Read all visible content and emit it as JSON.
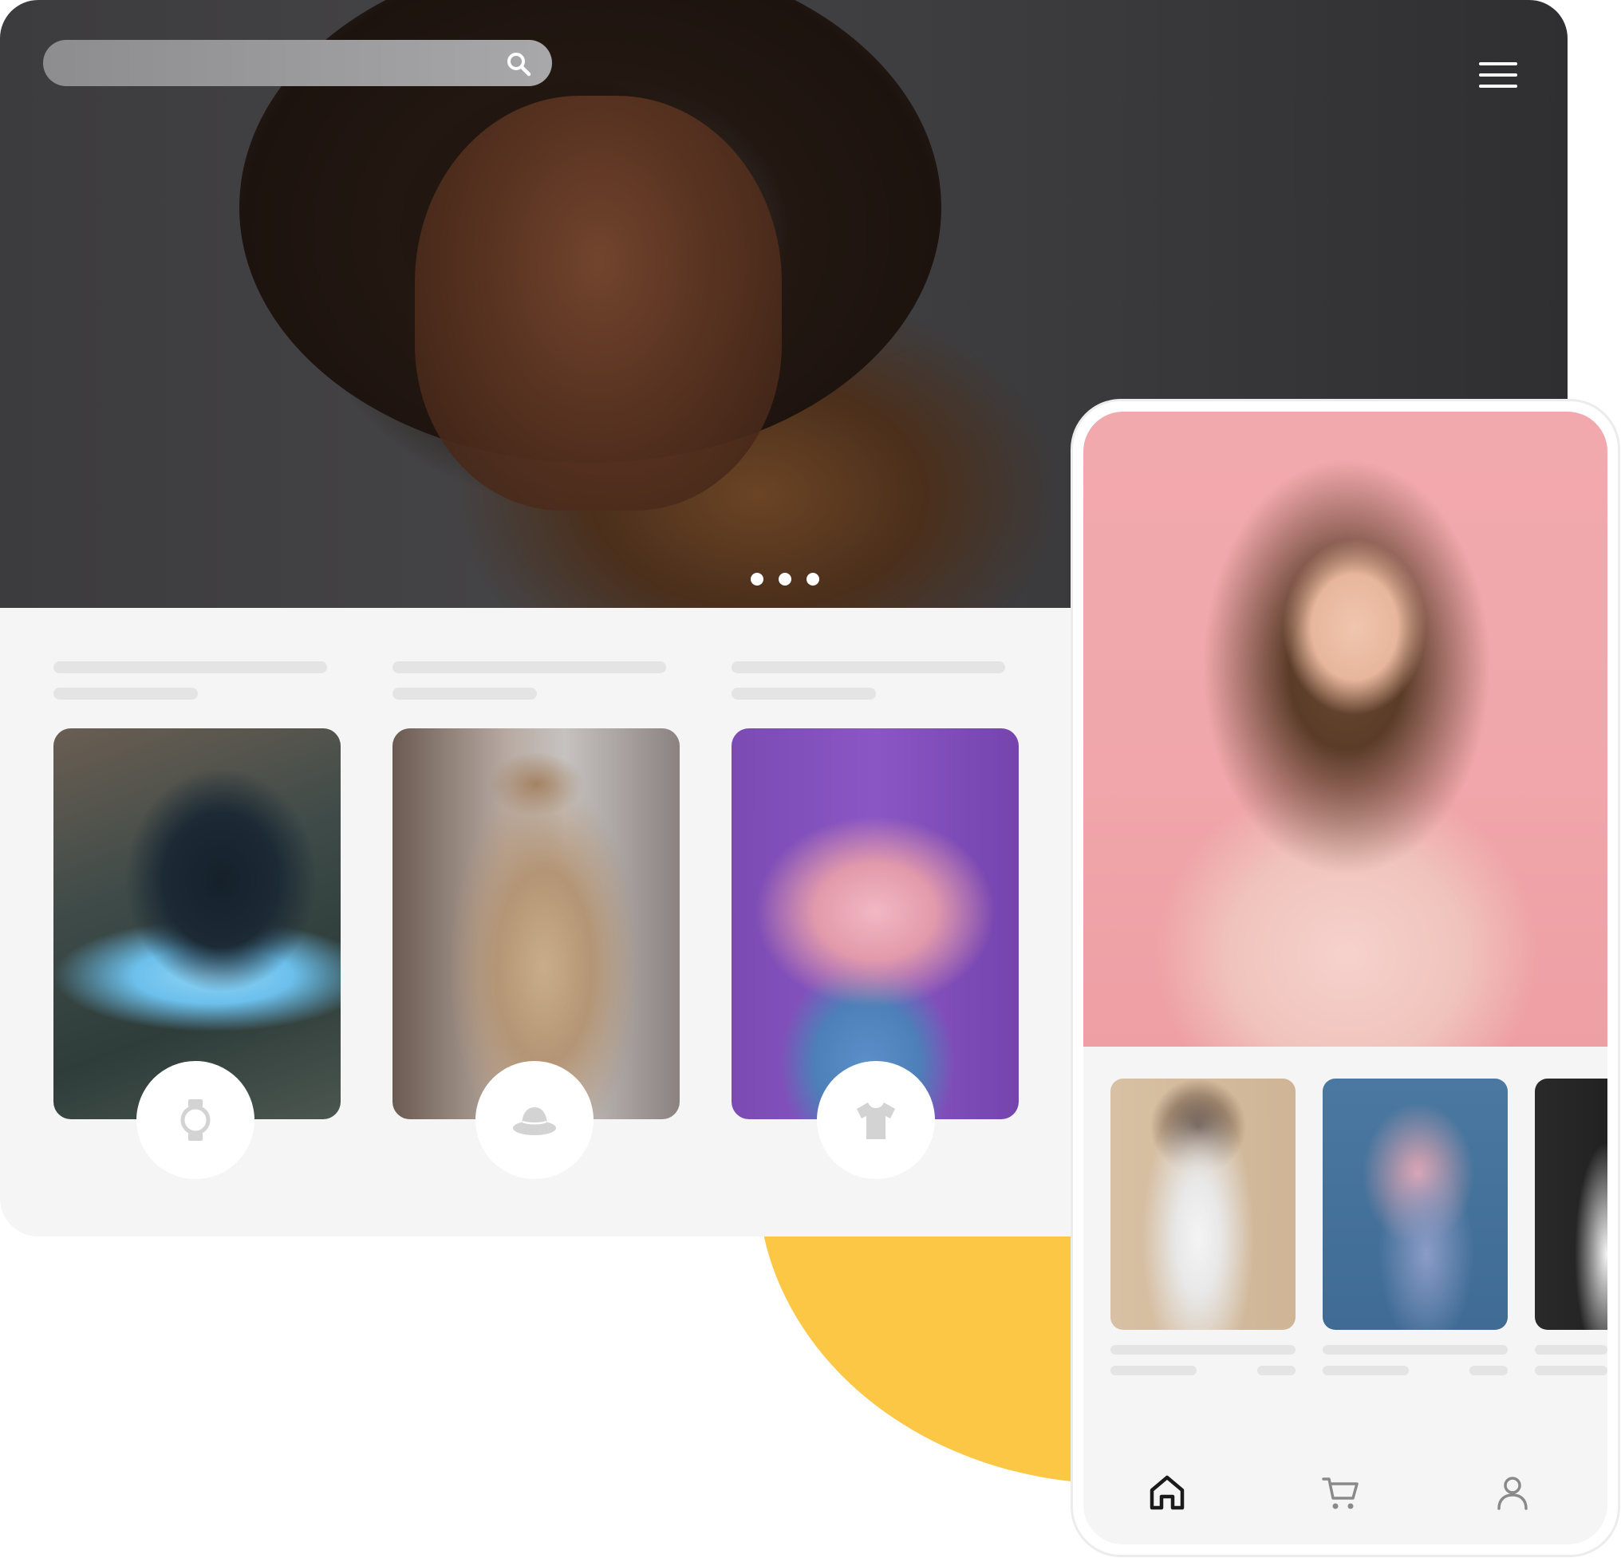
{
  "search": {
    "placeholder": "",
    "value": ""
  },
  "icons": {
    "search": "search-icon",
    "menu": "hamburger-menu-icon",
    "categories": [
      "watch-icon",
      "hat-icon",
      "tshirt-icon"
    ],
    "tabs": [
      "home-icon",
      "cart-icon",
      "user-icon"
    ]
  },
  "carousel": {
    "slide_count": 3,
    "active_index": 0
  },
  "colors": {
    "accent_yellow": "#fdc746",
    "panel_background": "#f5f5f5",
    "skeleton": "#e4e4e4",
    "icon_gray": "#d3d3d3",
    "active_tab": "#1a1a1a",
    "inactive_tab": "#8a8a8a"
  },
  "tabs": {
    "active": "home"
  }
}
